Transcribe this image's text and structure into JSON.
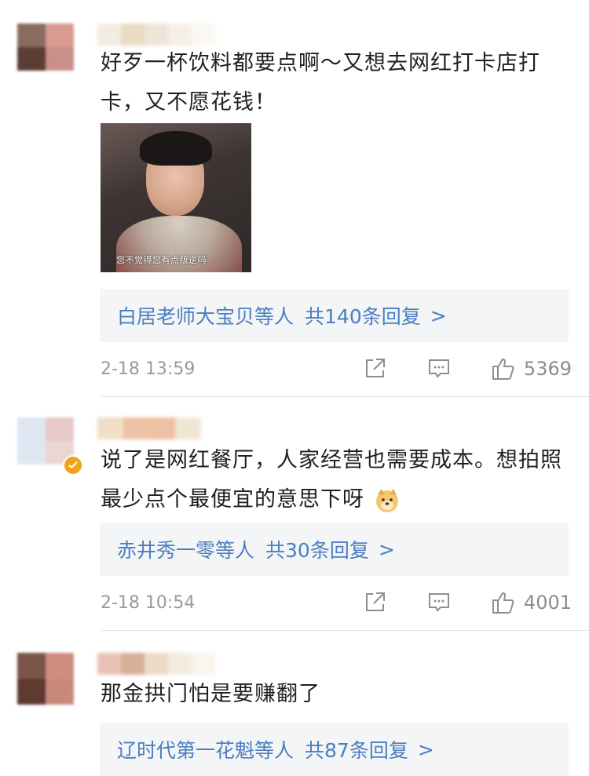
{
  "comments": [
    {
      "text": "好歹一杯饮料都要点啊～又想去网红打卡店打卡，又不愿花钱！",
      "meme_caption": "您不觉得您有点叛逆吗",
      "reply": {
        "users": "白居老师大宝贝",
        "suffix": "等人",
        "count": "共140条回复",
        "more": ">"
      },
      "time": "2-18 13:59",
      "likes": "5369"
    },
    {
      "text": "说了是网红餐厅，人家经营也需要成本。想拍照最少点个最便宜的意思下呀",
      "reply": {
        "users": "赤井秀一零",
        "suffix": "等人",
        "count": "共30条回复",
        "more": ">"
      },
      "time": "2-18 10:54",
      "likes": "4001"
    },
    {
      "text": "那金拱门怕是要赚翻了",
      "reply": {
        "users": "辽时代第一花魁",
        "suffix": "等人",
        "count": "共87条回复",
        "more": ">"
      }
    }
  ],
  "icons": {
    "share": "share-icon",
    "comment": "comment-icon",
    "like": "thumbs-up-icon",
    "verified": "verified-badge-icon",
    "emoji": "doge-emoji-icon"
  },
  "colors": {
    "link": "#4a7ec0",
    "meta": "#9a9a9a",
    "reply_bg": "#f4f5f7",
    "verified": "#f2a21b"
  }
}
